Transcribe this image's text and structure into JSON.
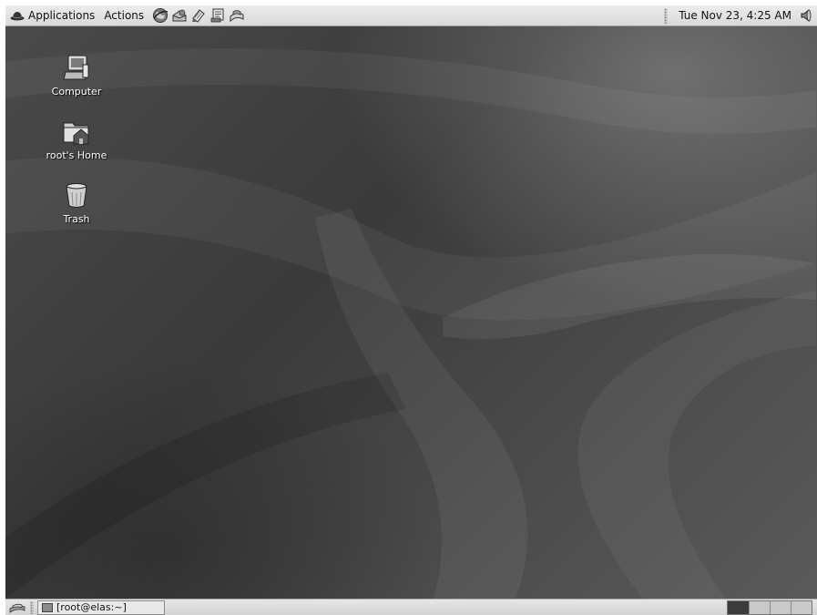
{
  "top_panel": {
    "menus": [
      {
        "label": "Applications",
        "icon": "redhat-hat-icon"
      },
      {
        "label": "Actions"
      }
    ],
    "launchers": [
      {
        "icon": "web-browser-icon"
      },
      {
        "icon": "email-icon"
      },
      {
        "icon": "text-editor-icon"
      },
      {
        "icon": "office-writer-icon"
      },
      {
        "icon": "print-manager-icon"
      }
    ],
    "clock": "Tue Nov 23,  4:25 AM",
    "volume_icon": "volume-icon"
  },
  "desktop": {
    "icons": [
      {
        "label": "Computer",
        "icon": "computer-icon"
      },
      {
        "label": "root's Home",
        "icon": "home-folder-icon"
      },
      {
        "label": "Trash",
        "icon": "trash-icon"
      }
    ]
  },
  "bottom_panel": {
    "show_desktop_icon": "show-desktop-icon",
    "tasks": [
      {
        "label": "[root@elas:~]",
        "icon": "terminal-icon"
      }
    ],
    "workspaces": {
      "count": 4,
      "active_index": 0
    }
  },
  "colors": {
    "panel_bg": "#e0e0e0",
    "desktop_bg": "#404040",
    "icon_label": "#ffffff"
  }
}
